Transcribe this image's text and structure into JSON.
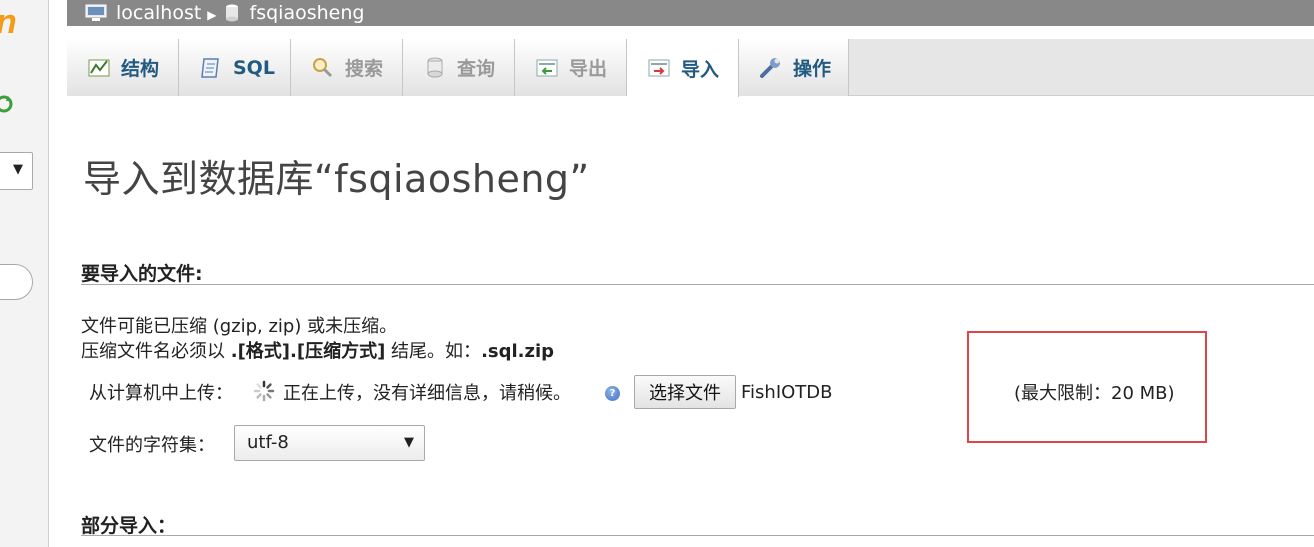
{
  "breadcrumb": {
    "server": "localhost",
    "database": "fsqiaosheng"
  },
  "tabs": [
    {
      "label": "结构",
      "icon": "structure-icon",
      "state": "normal"
    },
    {
      "label": "SQL",
      "icon": "sql-icon",
      "state": "normal"
    },
    {
      "label": "搜索",
      "icon": "search-icon",
      "state": "disabled"
    },
    {
      "label": "查询",
      "icon": "query-icon",
      "state": "disabled"
    },
    {
      "label": "导出",
      "icon": "export-icon",
      "state": "disabled"
    },
    {
      "label": "导入",
      "icon": "import-icon",
      "state": "active"
    },
    {
      "label": "操作",
      "icon": "wrench-icon",
      "state": "normal"
    }
  ],
  "page": {
    "title": "导入到数据库“fsqiaosheng”"
  },
  "file_section": {
    "heading": "要导入的文件:",
    "line1": "文件可能已压缩 (gzip, zip) 或未压缩。",
    "line2_prefix": "压缩文件名必须以 ",
    "line2_bold": ".[格式].[压缩方式]",
    "line2_mid": " 结尾。如：",
    "line2_example": ".sql.zip",
    "upload_label": "从计算机中上传：",
    "upload_status": "正在上传，没有详细信息，请稍候。",
    "choose_button": "选择文件",
    "chosen_file": "FishIOTDB",
    "max_limit": "(最大限制：20 MB)",
    "charset_label": "文件的字符集：",
    "charset_value": "utf-8"
  },
  "partial_section": {
    "heading": "部分导入："
  },
  "sidebar": {
    "logo_fragment": "n"
  },
  "colors": {
    "breadcrumb_bg": "#888888",
    "tab_text": "#235a81",
    "highlight_box": "#e14646",
    "logo": "#f29c1a"
  }
}
